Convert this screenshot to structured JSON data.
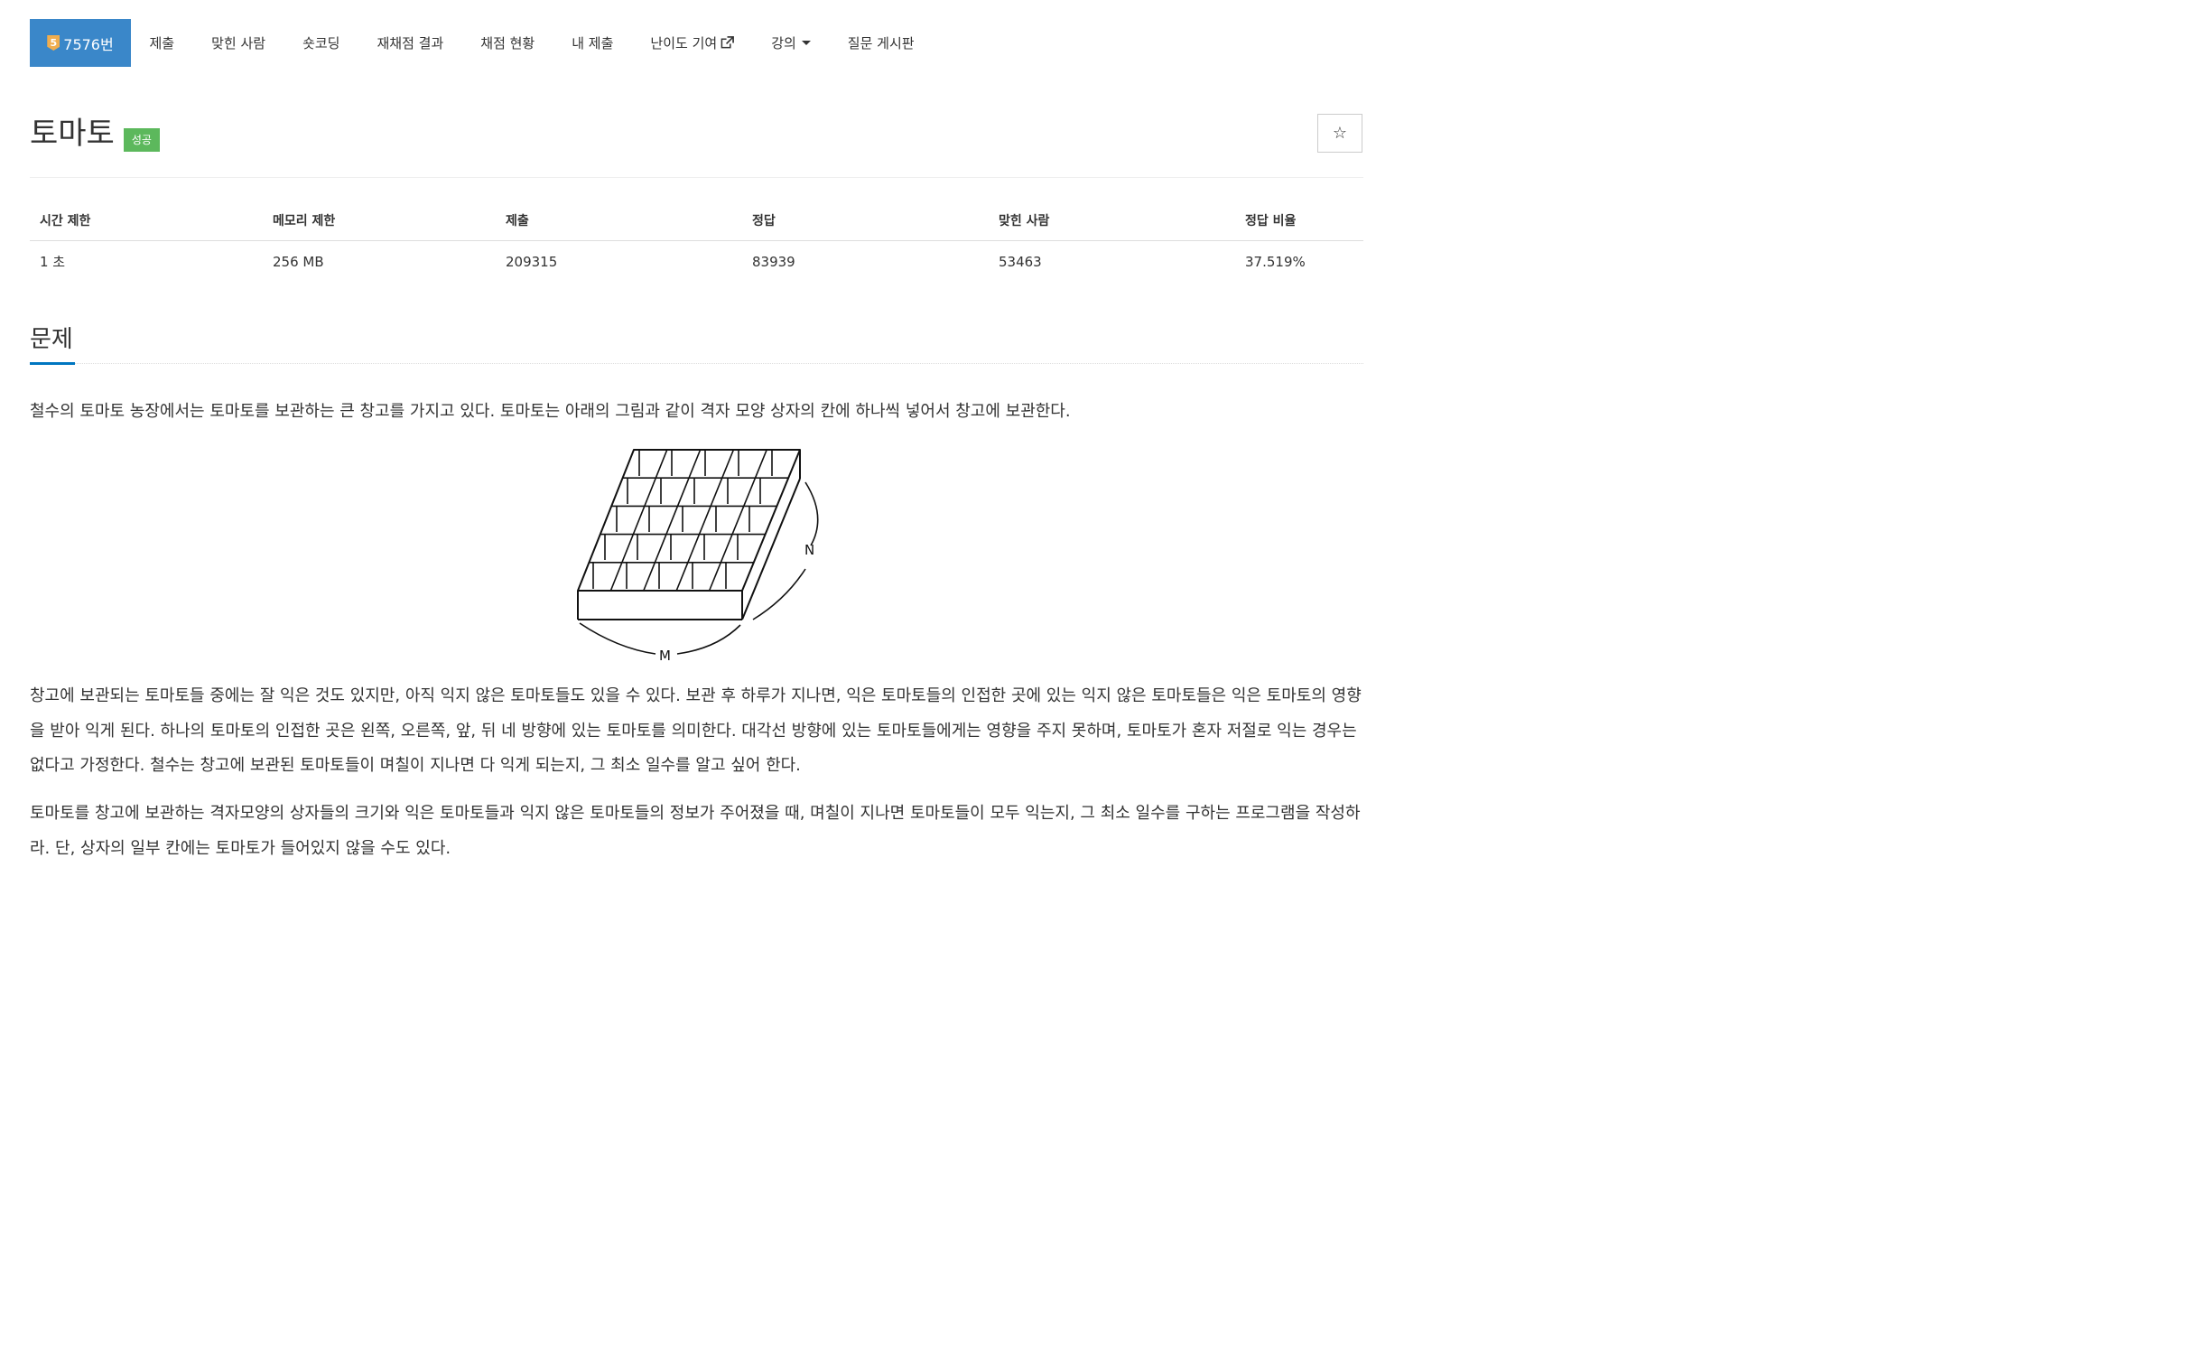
{
  "nav": {
    "problem_badge": "5",
    "problem_label": "7576번",
    "items": [
      "제출",
      "맞힌 사람",
      "숏코딩",
      "재채점 결과",
      "채점 현황",
      "내 제출",
      "난이도 기여",
      "강의",
      "질문 게시판"
    ]
  },
  "title": {
    "text": "토마토",
    "badge": "성공",
    "star": "☆"
  },
  "info": {
    "headers": [
      "시간 제한",
      "메모리 제한",
      "제출",
      "정답",
      "맞힌 사람",
      "정답 비율"
    ],
    "values": [
      "1 초",
      "256 MB",
      "209315",
      "83939",
      "53463",
      "37.519%"
    ]
  },
  "section": {
    "heading": "문제",
    "p1": "철수의 토마토 농장에서는 토마토를 보관하는 큰 창고를 가지고 있다. 토마토는 아래의 그림과 같이 격자 모양 상자의 칸에 하나씩 넣어서 창고에 보관한다.",
    "p2": "창고에 보관되는 토마토들 중에는 잘 익은 것도 있지만, 아직 익지 않은 토마토들도 있을 수 있다. 보관 후 하루가 지나면, 익은 토마토들의 인접한 곳에 있는 익지 않은 토마토들은 익은 토마토의 영향을 받아 익게 된다. 하나의 토마토의 인접한 곳은 왼쪽, 오른쪽, 앞, 뒤 네 방향에 있는 토마토를 의미한다. 대각선 방향에 있는 토마토들에게는 영향을 주지 못하며, 토마토가 혼자 저절로 익는 경우는 없다고 가정한다. 철수는 창고에 보관된 토마토들이 며칠이 지나면 다 익게 되는지, 그 최소 일수를 알고 싶어 한다.",
    "p3": "토마토를 창고에 보관하는 격자모양의 상자들의 크기와 익은 토마토들과 익지 않은 토마토들의 정보가 주어졌을 때, 며칠이 지나면 토마토들이 모두 익는지, 그 최소 일수를 구하는 프로그램을 작성하라. 단, 상자의 일부 칸에는 토마토가 들어있지 않을 수도 있다."
  },
  "figure": {
    "label_n": "N",
    "label_m": "M"
  },
  "colors": {
    "active_nav": "#3a87c9",
    "success": "#5cb85c",
    "section_underline": "#0076c0"
  }
}
